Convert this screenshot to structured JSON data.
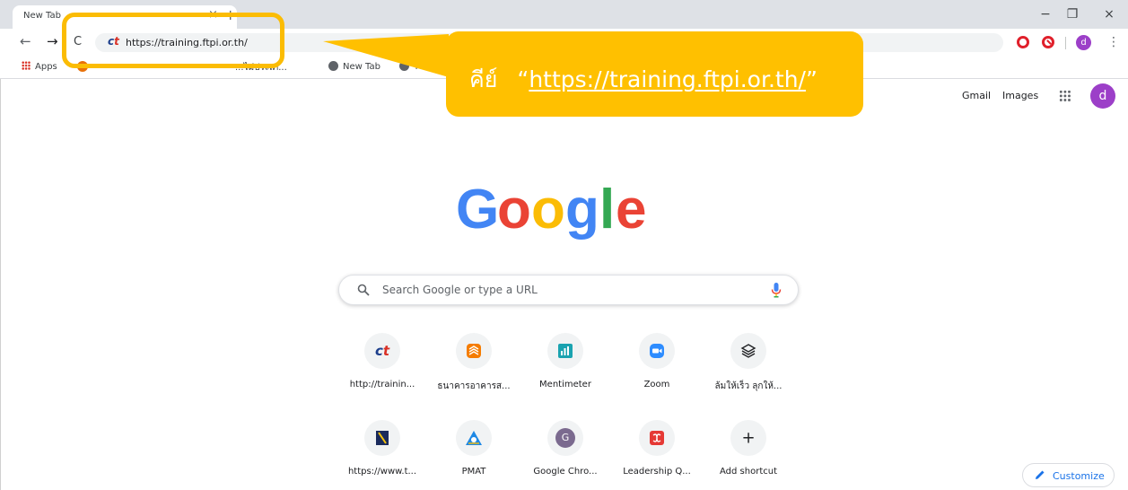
{
  "browser": {
    "tab_title": "New Tab",
    "tab_close_glyph": "×",
    "new_tab_glyph": "+",
    "window_controls": {
      "minimize": "−",
      "restore": "❐",
      "close": "×"
    },
    "nav": {
      "back": "←",
      "forward": "→",
      "reload": "C"
    },
    "address_url": "https://training.ftpi.or.th/",
    "profile_initial": "d",
    "menu_glyph": "⋮"
  },
  "bookmarks": {
    "items": [
      "Apps",
      "...ไม่ประเภ...",
      "New Tab",
      "TC"
    ]
  },
  "header": {
    "gmail": "Gmail",
    "images": "Images",
    "avatar_initial": "d"
  },
  "search": {
    "placeholder": "Search Google or type a URL"
  },
  "shortcuts": [
    {
      "label": "http://trainin...",
      "icon": "ftpi-logo-icon"
    },
    {
      "label": "ธนาคารอาคารส...",
      "icon": "bank-logo-icon"
    },
    {
      "label": "Mentimeter",
      "icon": "mentimeter-icon"
    },
    {
      "label": "Zoom",
      "icon": "zoom-icon"
    },
    {
      "label": "ล้มให้เร็ว ลุกให้...",
      "icon": "layers-icon"
    },
    {
      "label": "https://www.t...",
      "icon": "book-icon"
    },
    {
      "label": "PMAT",
      "icon": "pmat-logo-icon"
    },
    {
      "label": "Google Chro...",
      "icon": "g-letter-icon",
      "letter": "G"
    },
    {
      "label": "Leadership Q...",
      "icon": "leadership-icon"
    },
    {
      "label": "Add shortcut",
      "icon": "plus-icon",
      "glyph": "+"
    }
  ],
  "customize": {
    "label": "Customize"
  },
  "annotation": {
    "prefix": "คีย์",
    "quote_open": "“",
    "url": "https://training.ftpi.or.th/",
    "quote_close": "”",
    "color": "#ffc000"
  },
  "colors": {
    "google_blue": "#4285f4",
    "google_red": "#ea4335",
    "google_yellow": "#fbbc05",
    "google_green": "#34a853",
    "profile_purple": "#9c3fc8"
  }
}
